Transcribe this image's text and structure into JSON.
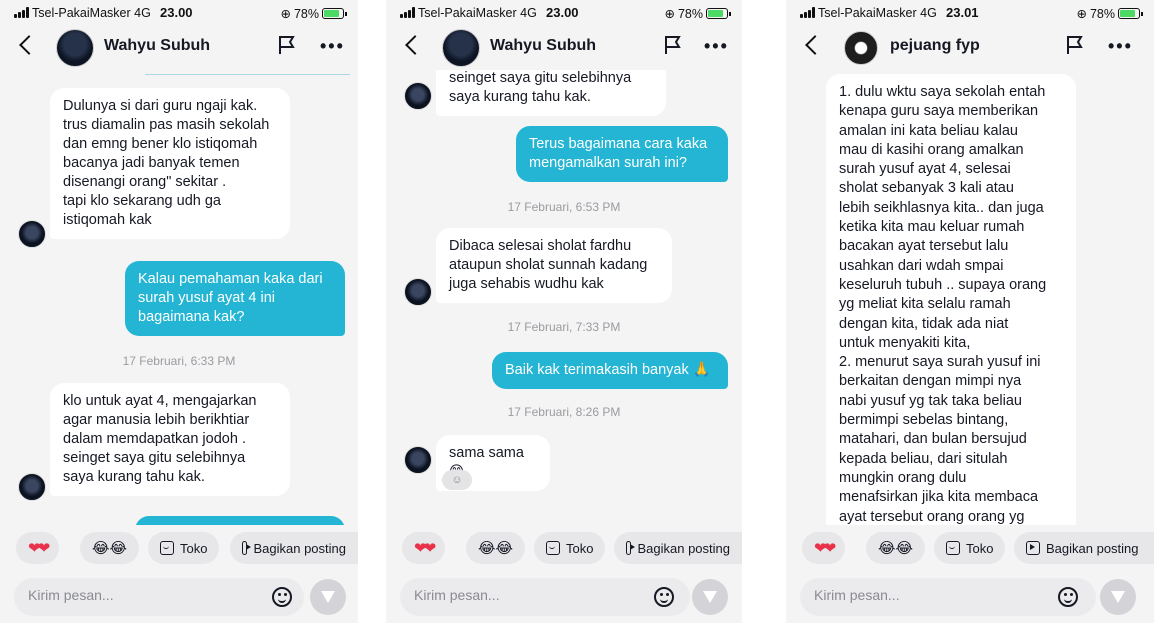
{
  "status": {
    "carrier": "Tsel-PakaiMasker",
    "network": "4G",
    "battery": "78%",
    "times": [
      "23.00",
      "23.00",
      "23.01"
    ]
  },
  "screens": [
    {
      "contact": "Wahyu Subuh",
      "messages": [
        {
          "type": "in",
          "text": "Dulunya si dari guru ngaji kak.\ntrus diamalin pas masih sekolah\ndan emng bener klo istiqomah\nbacanya jadi banyak temen\ndisenangi orang\" sekitar .\ntapi klo sekarang udh ga\nistiqomah kak"
        },
        {
          "type": "out",
          "text": "Kalau pemahaman kaka dari\nsurah yusuf ayat 4 ini\nbagaimana kak?"
        },
        {
          "type": "time",
          "text": "17 Februari, 6:33 PM"
        },
        {
          "type": "in",
          "text": "klo untuk ayat 4,  mengajarkan\nagar manusia lebih berikhtiar\ndalam memdapatkan jodoh .\nseinget saya gitu selebihnya\nsaya kurang tahu kak."
        }
      ]
    },
    {
      "contact": "Wahyu Subuh",
      "messages": [
        {
          "type": "in",
          "text": "seinget saya gitu selebihnya\nsaya kurang tahu kak."
        },
        {
          "type": "out",
          "text": "Terus bagaimana cara kaka\nmengamalkan surah ini?"
        },
        {
          "type": "time",
          "text": "17 Februari, 6:53 PM"
        },
        {
          "type": "in",
          "text": "Dibaca selesai sholat fardhu\nataupun sholat sunnah kadang\njuga sehabis wudhu kak"
        },
        {
          "type": "time",
          "text": "17 Februari, 7:33 PM"
        },
        {
          "type": "out",
          "text": "Baik kak terimakasih banyak 🙏"
        },
        {
          "type": "time",
          "text": "17 Februari, 8:26 PM"
        },
        {
          "type": "in",
          "text": "sama sama😁"
        }
      ]
    },
    {
      "contact": "pejuang fyp",
      "messages": [
        {
          "type": "in",
          "text": "1. dulu wktu saya sekolah entah\nkenapa guru saya memberikan\namalan ini kata beliau kalau\nmau di kasihi orang amalkan\nsurah yusuf ayat 4, selesai\nsholat sebanyak 3 kali atau\nlebih seikhlasnya kita.. dan juga\nketika kita mau keluar rumah\nbacakan ayat tersebut lalu\nusahkan dari wdah smpai\nkeseluruh tubuh .. supaya orang\nyg meliat kita selalu ramah\ndengan kita, tidak ada niat\nuntuk menyakiti kita,\n2. menurut saya surah yusuf ini\nberkaitan dengan mimpi nya\nnabi yusuf yg tak taka beliau\nbermimpi sebelas bintang,\nmatahari, dan bulan bersujud\nkepada beliau, dari situlah\nmungkin orang dulu\nmenafsirkan jika kita membaca\nayat tersebut orang orang yg"
        }
      ]
    }
  ],
  "quick_replies": {
    "heart": "❤❤",
    "laugh": "😂😂",
    "toko": "Toko",
    "share": "Bagikan posting"
  },
  "compose": {
    "placeholder": "Kirim pesan..."
  },
  "colors": {
    "outgoing_bubble": "#23b5d3",
    "incoming_bubble": "#ffffff",
    "background": "#f4f4f5"
  }
}
